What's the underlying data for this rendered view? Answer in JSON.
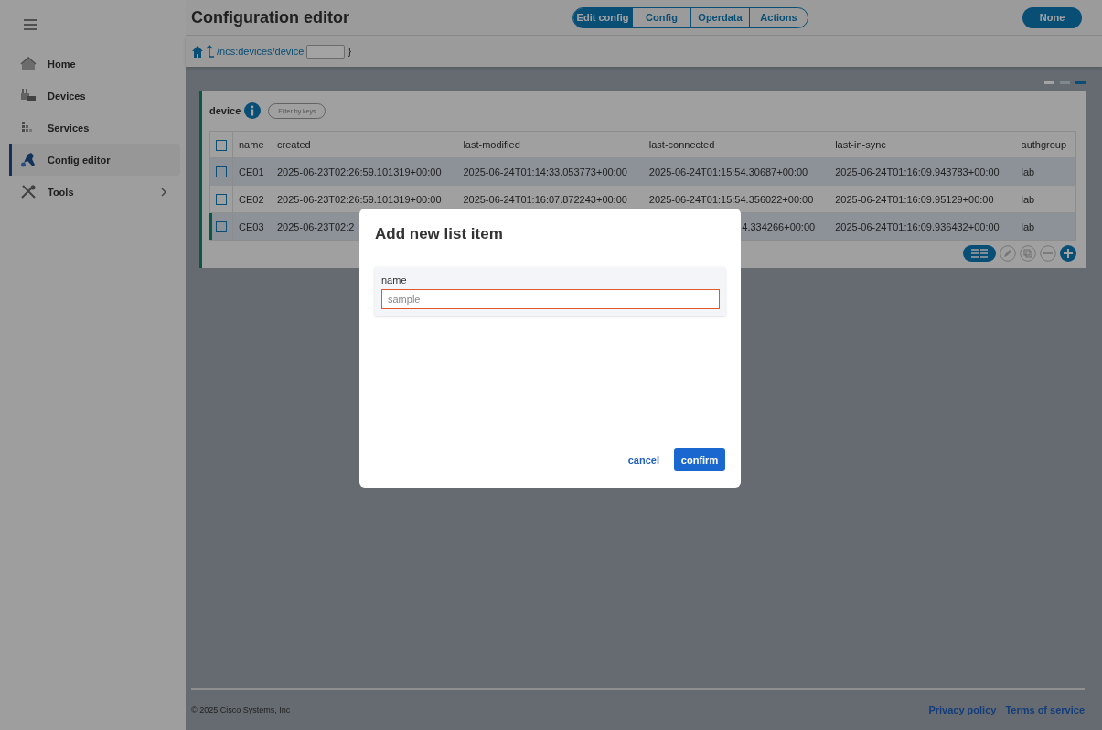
{
  "sidebar": {
    "items": [
      {
        "label": "Home",
        "selected": false
      },
      {
        "label": "Devices",
        "selected": false
      },
      {
        "label": "Services",
        "selected": false
      },
      {
        "label": "Config editor",
        "selected": true
      },
      {
        "label": "Tools",
        "selected": false,
        "has_submenu": true
      }
    ]
  },
  "header": {
    "title": "Configuration editor",
    "mode_tabs": [
      {
        "label": "Edit config",
        "selected": true
      },
      {
        "label": "Config",
        "selected": false
      },
      {
        "label": "Operdata",
        "selected": false
      },
      {
        "label": "Actions",
        "selected": false
      }
    ],
    "button": "None"
  },
  "breadcrumb": {
    "path": "/ncs:devices/device",
    "close": "}"
  },
  "list": {
    "title": "device",
    "filter_button": "Filter by keys",
    "all_checked": false,
    "columns": [
      "name",
      "created",
      "last-modified",
      "last-connected",
      "last-in-sync",
      "authgroup"
    ],
    "rows": [
      {
        "selected": false,
        "checked": false,
        "cells": [
          "CE01",
          "2025-06-23T02:26:59.101319+00:00",
          "2025-06-24T01:14:33.053773+00:00",
          "2025-06-24T01:15:54.30687+00:00",
          "2025-06-24T01:16:09.943783+00:00",
          "lab"
        ]
      },
      {
        "selected": false,
        "checked": false,
        "cells": [
          "CE02",
          "2025-06-23T02:26:59.101319+00:00",
          "2025-06-24T01:16:07.872243+00:00",
          "2025-06-24T01:15:54.356022+00:00",
          "2025-06-24T01:16:09.95129+00:00",
          "lab"
        ]
      },
      {
        "selected": true,
        "checked": false,
        "clipped_start": [
          false,
          false,
          false,
          true,
          false,
          false
        ],
        "cells": [
          "CE03",
          "2025-06-23T02:2",
          null,
          "4.334266+00:00",
          "2025-06-24T01:16:09.936432+00:00",
          "lab"
        ]
      }
    ]
  },
  "dialog": {
    "title": "Add new list item",
    "field_label": "name",
    "placeholder": "sample",
    "cancel": "cancel",
    "confirm": "confirm"
  },
  "footer": {
    "copyright": "© 2025 Cisco Systems, Inc",
    "links": [
      "Privacy policy",
      "Terms of service"
    ]
  }
}
